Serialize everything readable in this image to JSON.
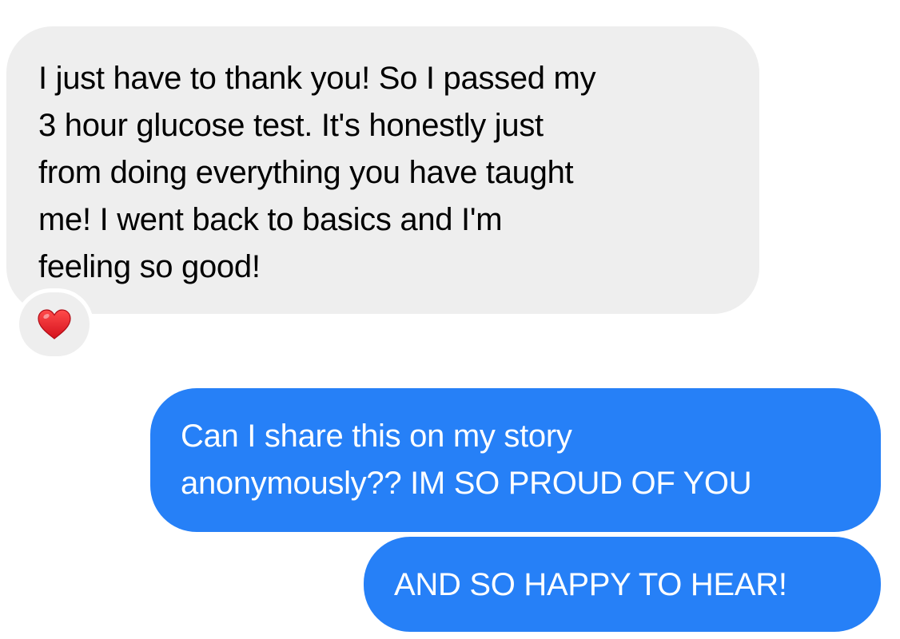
{
  "messages": [
    {
      "direction": "incoming",
      "text": "I just have to thank you! So I passed my\n3 hour glucose test. It's honestly just\nfrom doing everything you have taught\nme! I went back to basics and I'm\nfeeling so good!",
      "reaction": "heart-icon"
    },
    {
      "direction": "outgoing",
      "text": "Can I share this on my story\nanonymously?? IM SO PROUD OF YOU"
    },
    {
      "direction": "outgoing",
      "text": "AND SO HAPPY TO HEAR!"
    }
  ],
  "colors": {
    "incoming_bubble": "#eeeeee",
    "outgoing_bubble": "#2680f7",
    "heart": "#e8212c"
  }
}
